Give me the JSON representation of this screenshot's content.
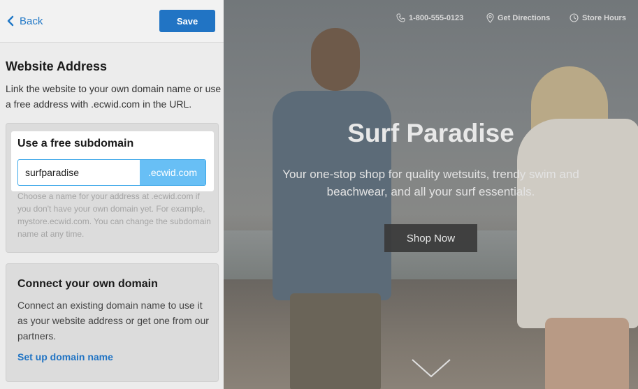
{
  "panel": {
    "back_label": "Back",
    "save_label": "Save",
    "section_title": "Website Address",
    "section_desc": "Link the website to your own domain name or use a free address with .ecwid.com in the URL.",
    "subdomain": {
      "title": "Use a free subdomain",
      "value": "surfparadise",
      "suffix": ".ecwid.com",
      "hint": "Choose a name for your address at .ecwid.com if you don't have your own domain yet. For example, mystore.ecwid.com. You can change the subdomain name at any time."
    },
    "own_domain": {
      "title": "Connect your own domain",
      "desc": "Connect an existing domain name to use it as your website address or get one from our partners.",
      "link": "Set up domain name"
    }
  },
  "preview": {
    "nav": {
      "phone": "1-800-555-0123",
      "directions": "Get Directions",
      "hours": "Store Hours"
    },
    "hero_title": "Surf Paradise",
    "hero_sub": "Your one-stop shop for quality wetsuits, trendy swim and beachwear, and all your surf essentials.",
    "shop_button": "Shop Now"
  },
  "colors": {
    "accent": "#2174c4",
    "field_border": "#3aa6e8",
    "suffix_bg": "#68bff5"
  },
  "icons": [
    "chevron-left-icon",
    "phone-icon",
    "location-pin-icon",
    "clock-icon",
    "chevron-down-icon"
  ]
}
